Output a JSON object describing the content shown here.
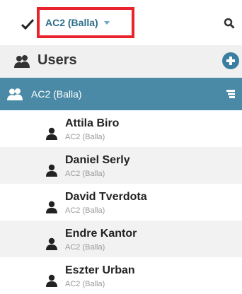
{
  "topbar": {
    "group_switcher_label": "AC2 (Balla)"
  },
  "users_header": {
    "title": "Users"
  },
  "group": {
    "label": "AC2 (Balla)"
  },
  "users": [
    {
      "name": "Attila Biro",
      "group": "AC2 (Balla)"
    },
    {
      "name": "Daniel Serly",
      "group": "AC2 (Balla)"
    },
    {
      "name": "David Tverdota",
      "group": "AC2 (Balla)"
    },
    {
      "name": "Endre Kantor",
      "group": "AC2 (Balla)"
    },
    {
      "name": "Eszter Urban",
      "group": "AC2 (Balla)"
    }
  ],
  "colors": {
    "accent": "#4a8aa6",
    "link": "#2c6e8a",
    "highlight_box": "#e8232b"
  }
}
